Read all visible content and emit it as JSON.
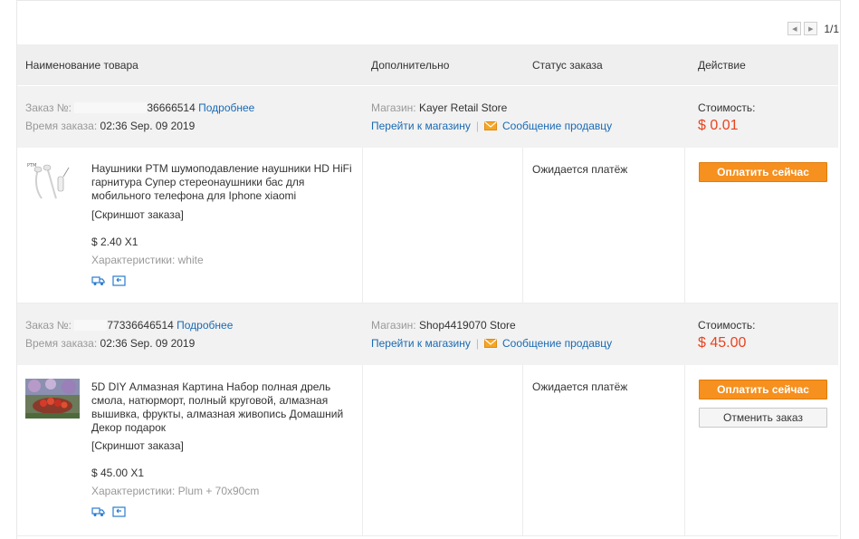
{
  "pager": {
    "text": "1/1"
  },
  "columns": {
    "product": "Наименование товара",
    "extra": "Дополнительно",
    "status": "Статус заказа",
    "action": "Действие"
  },
  "orders": [
    {
      "order_label": "Заказ №:",
      "order_number": "36666514",
      "details_link": "Подробнее",
      "time_label": "Время заказа:",
      "time_value": "02:36 Sep. 09 2019",
      "store_label": "Магазин:",
      "store_name": "Kayer Retail Store",
      "go_store": "Перейти к магазину",
      "separator": "|",
      "message_seller": "Сообщение продавцу",
      "cost_label": "Стоимость:",
      "cost_value": "$ 0.01",
      "item": {
        "title": "Наушники PTM шумоподавление наушники HD HiFi гарнитура Супер стереонаушники бас для мобильного телефона для Iphone xiaomi",
        "screenshot": "[Скриншот заказа]",
        "price_qty": "$ 2.40 X1",
        "props": "Характеристики: white",
        "status": "Ожидается платёж",
        "pay_button": "Оплатить сейчас"
      }
    },
    {
      "order_label": "Заказ №:",
      "order_number": "77336646514",
      "details_link": "Подробнее",
      "time_label": "Время заказа:",
      "time_value": "02:36 Sep. 09 2019",
      "store_label": "Магазин:",
      "store_name": "Shop4419070 Store",
      "go_store": "Перейти к магазину",
      "separator": "|",
      "message_seller": "Сообщение продавцу",
      "cost_label": "Стоимость:",
      "cost_value": "$ 45.00",
      "item": {
        "title": "5D DIY Алмазная Картина Набор полная дрель смола, натюрморт, полный круговой, алмазная вышивка, фрукты, алмазная живопись Домашний Декор подарок",
        "screenshot": "[Скриншот заказа]",
        "price_qty": "$ 45.00 X1",
        "props": "Характеристики: Plum + 70x90cm",
        "status": "Ожидается платёж",
        "pay_button": "Оплатить сейчас",
        "cancel_button": "Отменить заказ"
      }
    }
  ],
  "colors": {
    "accent": "#f6901e",
    "link": "#1a6ab3",
    "price": "#e8441e"
  }
}
